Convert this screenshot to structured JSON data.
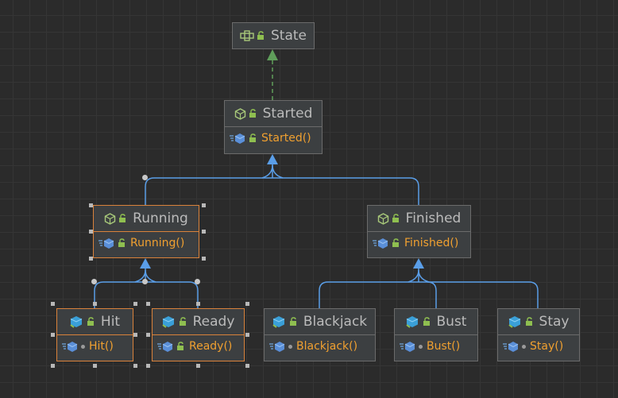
{
  "diagram": {
    "nodes": {
      "state": {
        "name": "State",
        "kind": "interface"
      },
      "started": {
        "name": "Started",
        "kind": "abstract-class",
        "member": "Started()"
      },
      "running": {
        "name": "Running",
        "kind": "abstract-class",
        "member": "Running()"
      },
      "finished": {
        "name": "Finished",
        "kind": "abstract-class",
        "member": "Finished()"
      },
      "hit": {
        "name": "Hit",
        "kind": "class",
        "member": "Hit()"
      },
      "ready": {
        "name": "Ready",
        "kind": "class",
        "member": "Ready()"
      },
      "blackjack": {
        "name": "Blackjack",
        "kind": "class",
        "member": "Blackjack()"
      },
      "bust": {
        "name": "Bust",
        "kind": "class",
        "member": "Bust()"
      },
      "stay": {
        "name": "Stay",
        "kind": "class",
        "member": "Stay()"
      }
    },
    "edges": [
      {
        "from": "Started",
        "to": "State",
        "type": "implements"
      },
      {
        "from": "Running",
        "to": "Started",
        "type": "extends"
      },
      {
        "from": "Finished",
        "to": "Started",
        "type": "extends"
      },
      {
        "from": "Hit",
        "to": "Running",
        "type": "extends"
      },
      {
        "from": "Ready",
        "to": "Running",
        "type": "extends"
      },
      {
        "from": "Blackjack",
        "to": "Finished",
        "type": "extends"
      },
      {
        "from": "Bust",
        "to": "Finished",
        "type": "extends"
      },
      {
        "from": "Stay",
        "to": "Finished",
        "type": "extends"
      }
    ],
    "selected": [
      "Running",
      "Hit",
      "Ready"
    ],
    "colors": {
      "background": "#2b2b2b",
      "node_fill": "#3c3f41",
      "node_border": "#6b6b6b",
      "selected_border": "#d9823b",
      "name_text": "#bbbbbb",
      "method_text": "#f0a030",
      "extends_edge": "#5a9ee8",
      "implements_edge": "#5f9e5a"
    }
  }
}
